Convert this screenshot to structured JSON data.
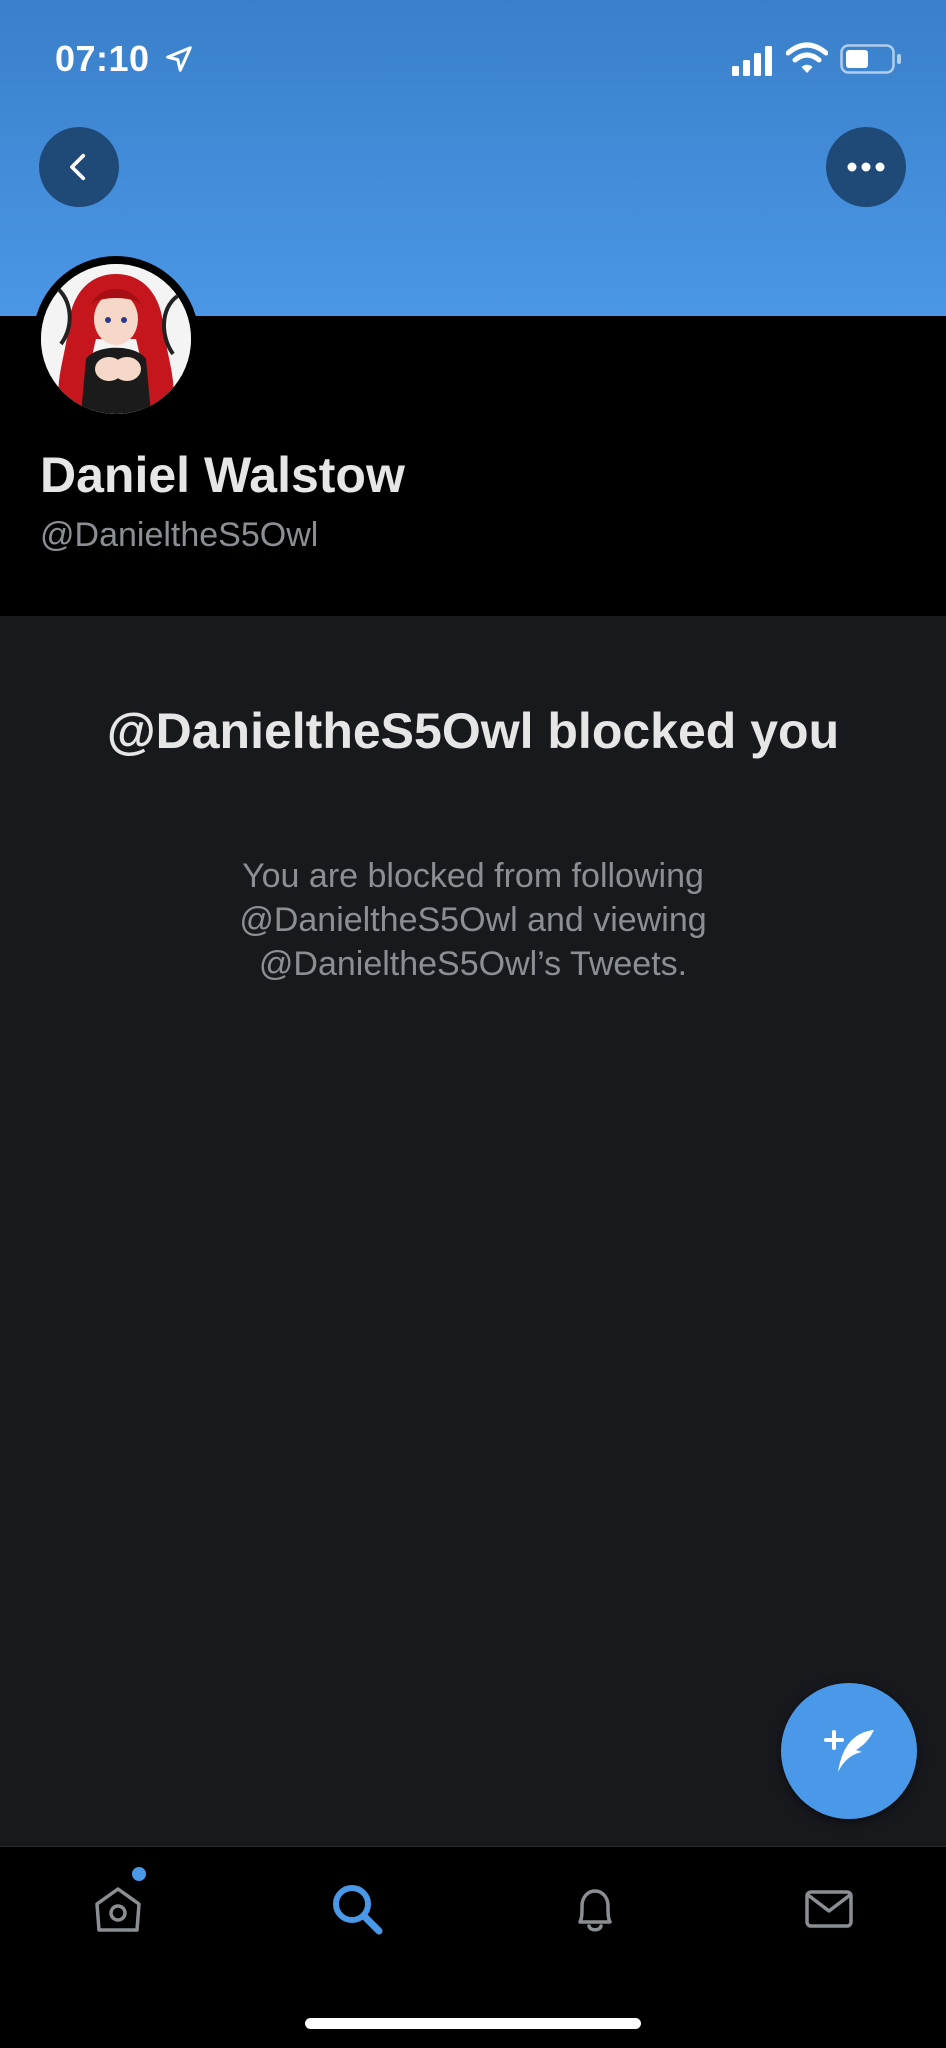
{
  "status_bar": {
    "time": "07:10",
    "icons": [
      "location-arrow-icon",
      "signal-icon",
      "wifi-icon",
      "battery-icon"
    ]
  },
  "header": {
    "back_icon": "chevron-left-icon",
    "more_icon": "ellipsis-icon",
    "banner_color": "#4a97e6"
  },
  "profile": {
    "display_name": "Daniel Walstow",
    "handle": "@DanieltheS5Owl"
  },
  "blocked_notice": {
    "title": "@DanieltheS5Owl blocked you",
    "description": "You are blocked from following @DanieltheS5Owl and viewing @DanieltheS5Owl’s Tweets."
  },
  "fab": {
    "icon": "compose-tweet-icon",
    "color": "#4a99e9"
  },
  "tabbar": {
    "tabs": [
      {
        "name": "home",
        "icon": "home-icon",
        "active": false,
        "has_badge": true
      },
      {
        "name": "search",
        "icon": "search-icon",
        "active": true
      },
      {
        "name": "notifications",
        "icon": "bell-icon",
        "active": false
      },
      {
        "name": "messages",
        "icon": "envelope-icon",
        "active": false
      }
    ],
    "active_color": "#4a99e9",
    "inactive_color": "#8b8f94"
  }
}
